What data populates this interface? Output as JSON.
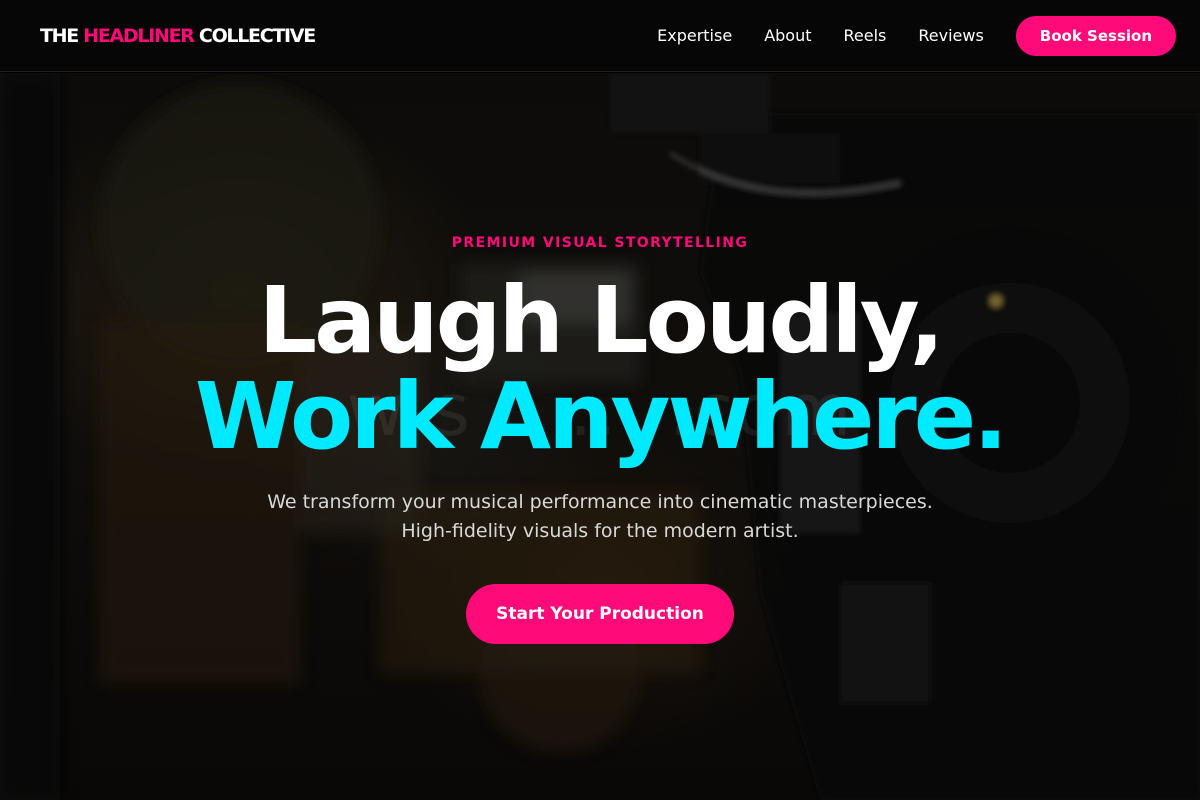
{
  "brand": {
    "part1": "THE ",
    "part2": "HEADLINER",
    "part3": " COLLECTIVE",
    "accent_color": "#ff0a78"
  },
  "nav": {
    "items": [
      {
        "label": "Expertise"
      },
      {
        "label": "About"
      },
      {
        "label": "Reels"
      },
      {
        "label": "Reviews"
      }
    ],
    "book_label": "Book Session"
  },
  "hero": {
    "eyebrow": "PREMIUM VISUAL STORYTELLING",
    "headline_line1": "Laugh Loudly,",
    "headline_line2": "Work Anywhere.",
    "subtitle_line1": "We transform your musical performance into cinematic masterpieces.",
    "subtitle_line2": "High-fidelity visuals for the modern artist.",
    "cta_label": "Start Your Production",
    "headline_accent_color": "#00eaff",
    "background_image": "blurred-video-camera-photo"
  }
}
